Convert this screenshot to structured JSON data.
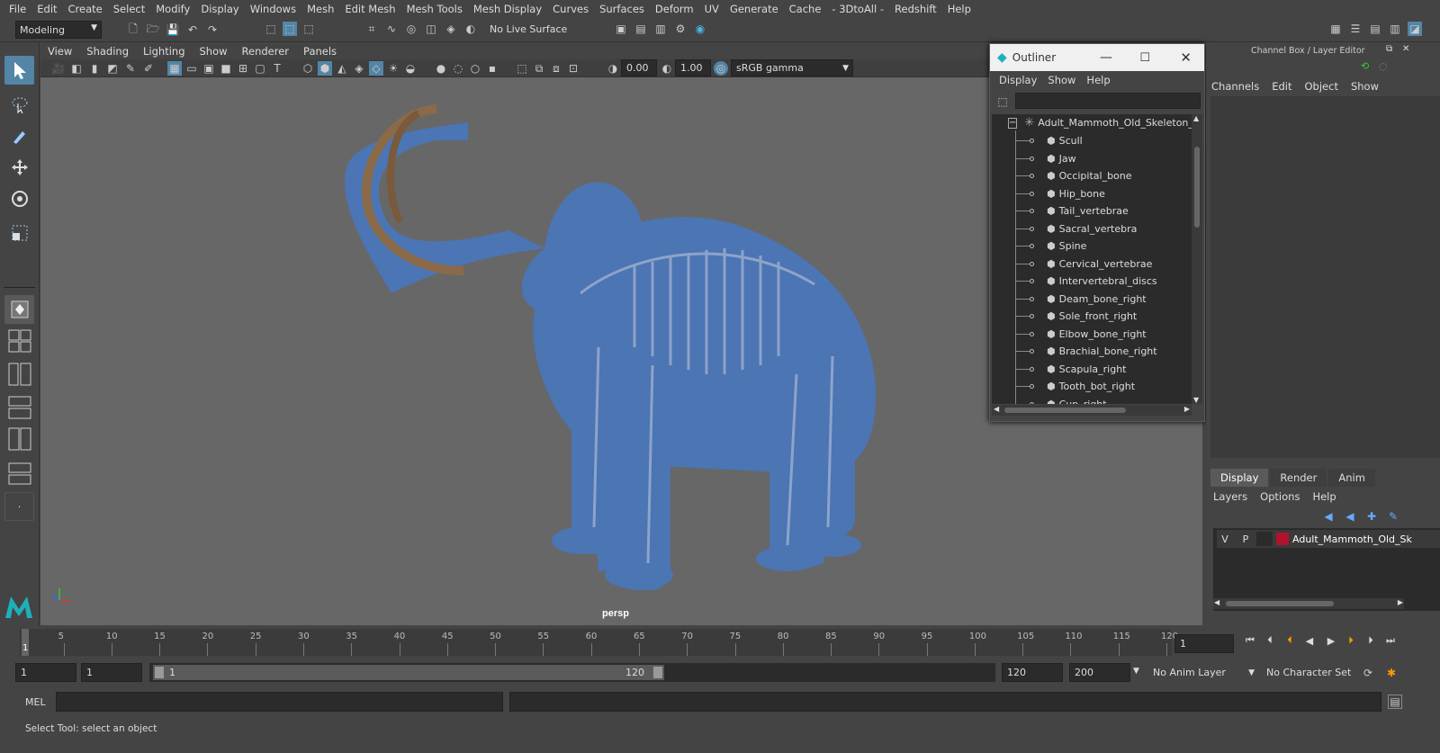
{
  "menu": [
    "File",
    "Edit",
    "Create",
    "Select",
    "Modify",
    "Display",
    "Windows",
    "Mesh",
    "Edit Mesh",
    "Mesh Tools",
    "Mesh Display",
    "Curves",
    "Surfaces",
    "Deform",
    "UV",
    "Generate",
    "Cache",
    "- 3DtoAll -",
    "Redshift",
    "Help"
  ],
  "shelf": {
    "mode": "Modeling",
    "live_surface": "No Live Surface"
  },
  "viewport": {
    "menu": [
      "View",
      "Shading",
      "Lighting",
      "Show",
      "Renderer",
      "Panels"
    ],
    "exposure": "0.00",
    "gamma": "1.00",
    "color_space": "sRGB gamma",
    "camera": "persp"
  },
  "outliner": {
    "title": "Outliner",
    "menu": [
      "Display",
      "Show",
      "Help"
    ],
    "root": "Adult_Mammoth_Old_Skeleton_",
    "items": [
      "Scull",
      "Jaw",
      "Occipital_bone",
      "Hip_bone",
      "Tail_vertebrae",
      "Sacral_vertebra",
      "Spine",
      "Cervical_vertebrae",
      "Intervertebral_discs",
      "Deam_bone_right",
      "Sole_front_right",
      "Elbow_bone_right",
      "Brachial_bone_right",
      "Scapula_right",
      "Tooth_bot_right",
      "Cup_right"
    ]
  },
  "channel_box": {
    "title": "Channel Box / Layer Editor",
    "menu": [
      "Channels",
      "Edit",
      "Object",
      "Show"
    ],
    "tabs": [
      "Display",
      "Render",
      "Anim"
    ],
    "layer_menu": [
      "Layers",
      "Options",
      "Help"
    ],
    "layer": {
      "v": "V",
      "p": "P",
      "name": "Adult_Mammoth_Old_Sk",
      "color": "#b0132e"
    }
  },
  "timeline": {
    "ticks": [
      "5",
      "10",
      "15",
      "20",
      "25",
      "30",
      "35",
      "40",
      "45",
      "50",
      "55",
      "60",
      "65",
      "70",
      "75",
      "80",
      "85",
      "90",
      "95",
      "100",
      "105",
      "110",
      "115",
      "120"
    ],
    "current_marker": "1",
    "current_frame": "1"
  },
  "range": {
    "start": "1",
    "playback_start": "1",
    "slider_start": "1",
    "slider_end": "120",
    "playback_end": "120",
    "end": "200",
    "anim_layer": "No Anim Layer",
    "character_set": "No Character Set"
  },
  "cmd": {
    "label": "MEL"
  },
  "status": "Select Tool: select an object"
}
